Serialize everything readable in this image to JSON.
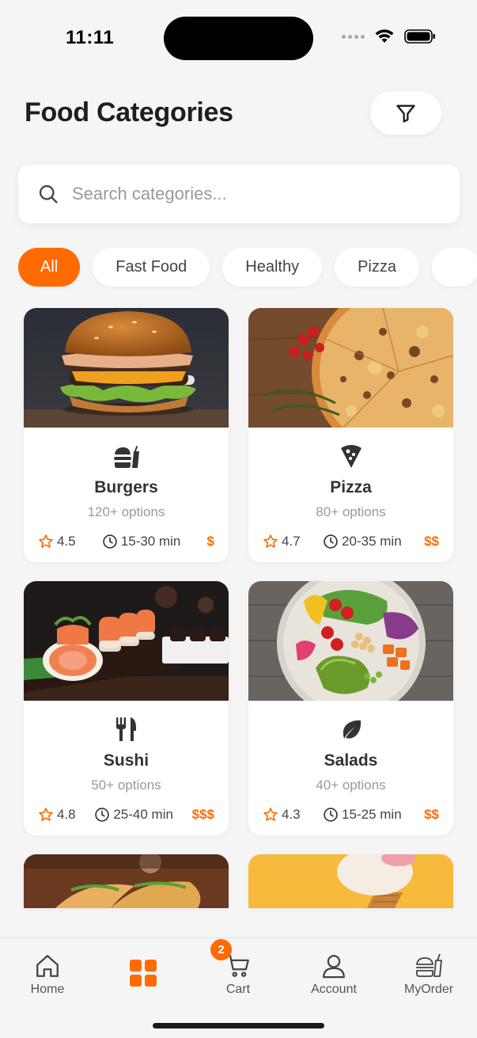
{
  "status_bar": {
    "time": "11:11"
  },
  "header": {
    "title": "Food Categories",
    "filter_icon": "filter-icon"
  },
  "search": {
    "placeholder": "Search categories...",
    "value": ""
  },
  "chips": [
    {
      "label": "All",
      "active": true
    },
    {
      "label": "Fast Food",
      "active": false
    },
    {
      "label": "Healthy",
      "active": false
    },
    {
      "label": "Pizza",
      "active": false
    }
  ],
  "categories": [
    {
      "name": "Burgers",
      "options": "120+ options",
      "rating": "4.5",
      "time": "15-30 min",
      "price": "$",
      "icon": "burger-icon"
    },
    {
      "name": "Pizza",
      "options": "80+ options",
      "rating": "4.7",
      "time": "20-35 min",
      "price": "$$",
      "icon": "pizza-slice-icon"
    },
    {
      "name": "Sushi",
      "options": "50+ options",
      "rating": "4.8",
      "time": "25-40 min",
      "price": "$$$",
      "icon": "utensils-icon"
    },
    {
      "name": "Salads",
      "options": "40+ options",
      "rating": "4.3",
      "time": "15-25 min",
      "price": "$$",
      "icon": "leaf-icon"
    }
  ],
  "bottom_nav": {
    "items": [
      {
        "label": "Home",
        "icon": "home-icon",
        "active": false
      },
      {
        "label": "",
        "icon": "grid-icon",
        "active": true
      },
      {
        "label": "Cart",
        "icon": "cart-icon",
        "active": false
      },
      {
        "label": "Account",
        "icon": "user-icon",
        "active": false
      },
      {
        "label": "MyOrder",
        "icon": "burger-icon",
        "active": false
      }
    ],
    "cart_badge": "2"
  },
  "colors": {
    "accent": "#ff6b00",
    "background": "#f5f5f5",
    "card": "#ffffff"
  }
}
